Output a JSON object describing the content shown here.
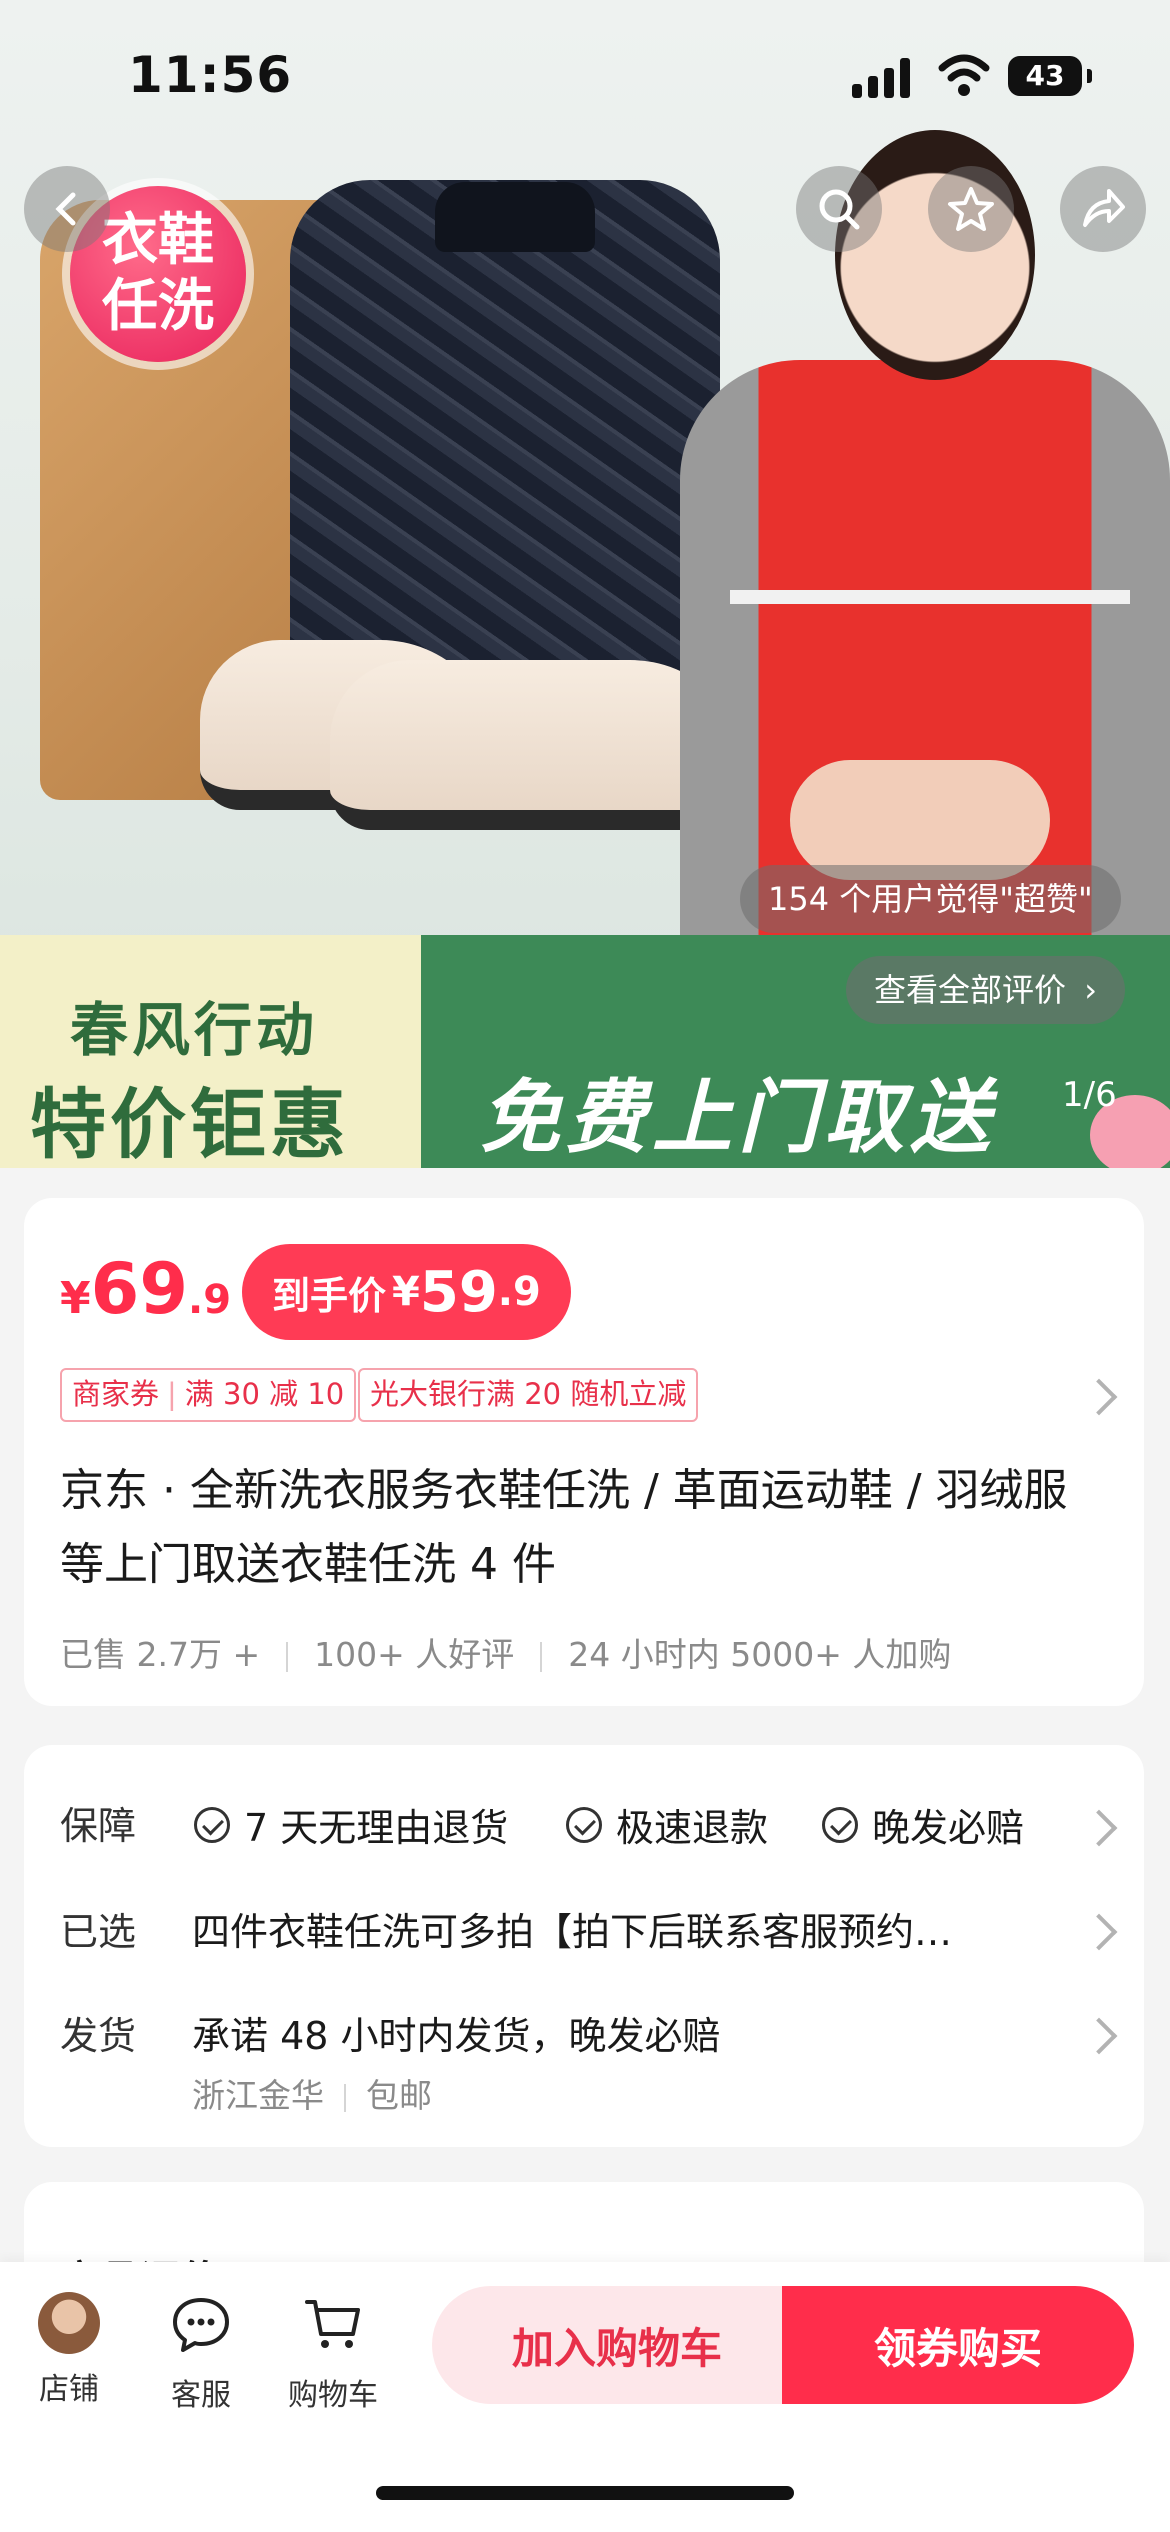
{
  "status_bar": {
    "time": "11:56",
    "battery": "43"
  },
  "hero": {
    "badge_text": [
      "衣鞋",
      "任洗"
    ],
    "review_hint": "154 个用户觉得\"超赞\"",
    "view_all_reviews": "查看全部评价",
    "image_index": "1/6",
    "banner": {
      "line1": "春风行动",
      "line2": "特价钜惠",
      "line3": "免费上门取送"
    }
  },
  "price": {
    "currency": "¥",
    "main_int": "69",
    "main_dec": ".9",
    "final_label": "到手价",
    "final_currency": "¥",
    "final_int": "59",
    "final_dec": ".9"
  },
  "coupons": [
    {
      "left": "商家券",
      "right": "满 30 减 10"
    },
    {
      "text": "光大银行满 20 随机立减"
    }
  ],
  "product_title": "京东 · 全新洗衣服务衣鞋任洗 / 革面运动鞋 / 羽绒服等上门取送衣鞋任洗 4 件",
  "stats": [
    "已售 2.7万 +",
    "100+ 人好评",
    "24 小时内 5000+ 人加购"
  ],
  "service": {
    "guarantee_label": "保障",
    "guarantees": [
      "7 天无理由退货",
      "极速退款",
      "晚发必赔"
    ],
    "selected_label": "已选",
    "selected_value": "四件衣鞋任洗可多拍【拍下后联系客服预约…",
    "shipping_label": "发货",
    "shipping_value": "承诺 48 小时内发货，晚发必赔",
    "shipping_origin": "浙江金华",
    "shipping_fee": "包邮"
  },
  "reviews_section": {
    "title": "商品评价"
  },
  "bottom_nav": {
    "store": "店铺",
    "service": "客服",
    "cart": "购物车",
    "add_to_cart": "加入购物车",
    "buy_with_coupon": "领券购买"
  },
  "colors": {
    "accent": "#ff2d4b",
    "banner_green": "#3d8a57"
  }
}
